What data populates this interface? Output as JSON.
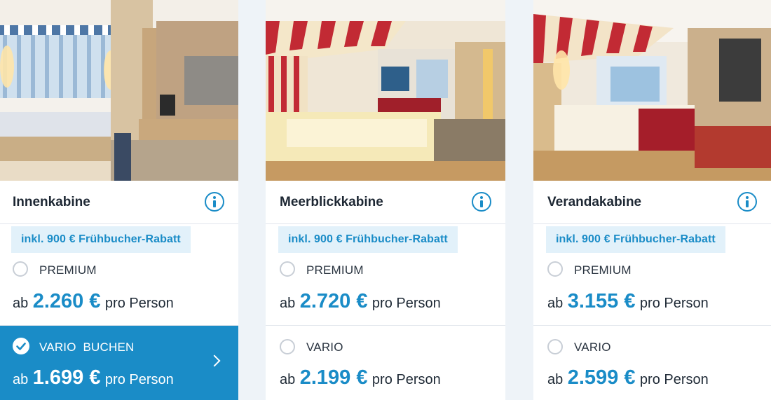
{
  "colors": {
    "accent": "#1a8cc7",
    "badge_bg": "#e2f1fa",
    "page_bg": "#eef3f8",
    "selected_bg": "#1a8cc7"
  },
  "cabins": [
    {
      "title": "Innenkabine",
      "image_alt": "Innenkabine room photo",
      "info_icon": "info-icon",
      "badge": "inkl. 900 € Frühbucher-Rabatt",
      "premium": {
        "label": "PREMIUM",
        "ab": "ab",
        "price": "2.260 €",
        "per": "pro Person",
        "selected": false
      },
      "vario": {
        "label": "VARIO  BUCHEN",
        "ab": "ab",
        "price": "1.699 €",
        "per": "pro Person",
        "selected": true
      }
    },
    {
      "title": "Meerblickkabine",
      "image_alt": "Meerblickkabine room photo",
      "info_icon": "info-icon",
      "badge": "inkl. 900 € Frühbucher-Rabatt",
      "premium": {
        "label": "PREMIUM",
        "ab": "ab",
        "price": "2.720 €",
        "per": "pro Person",
        "selected": false
      },
      "vario": {
        "label": "VARIO",
        "ab": "ab",
        "price": "2.199 €",
        "per": "pro Person",
        "selected": false
      }
    },
    {
      "title": "Verandakabine",
      "image_alt": "Verandakabine room photo",
      "info_icon": "info-icon",
      "badge": "inkl. 900 € Frühbucher-Rabatt",
      "premium": {
        "label": "PREMIUM",
        "ab": "ab",
        "price": "3.155 €",
        "per": "pro Person",
        "selected": false
      },
      "vario": {
        "label": "VARIO",
        "ab": "ab",
        "price": "2.599 €",
        "per": "pro Person",
        "selected": false
      }
    }
  ]
}
